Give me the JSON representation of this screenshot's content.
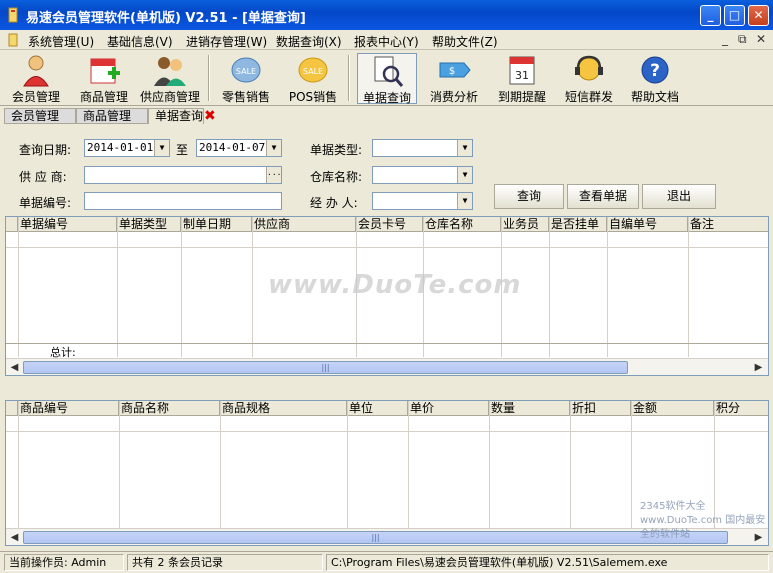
{
  "window": {
    "title": "易速会员管理软件(单机版) V2.51 - [单据查询]",
    "buttons": {
      "minimize": "_",
      "maximize": "□",
      "close": "✕"
    }
  },
  "menu": {
    "items": [
      "系统管理(U)",
      "基础信息(V)",
      "进销存管理(W)",
      "数据查询(X)",
      "报表中心(Y)",
      "帮助文件(Z)"
    ],
    "mdi_controls": [
      "_",
      "⧉",
      "✕"
    ]
  },
  "toolbar": {
    "buttons": [
      {
        "label": "会员管理",
        "icon": "member-icon"
      },
      {
        "label": "商品管理",
        "icon": "goods-icon"
      },
      {
        "label": "供应商管理",
        "icon": "supplier-icon"
      },
      {
        "label": "零售销售",
        "icon": "sale-icon"
      },
      {
        "label": "POS销售",
        "icon": "pos-sale-icon"
      },
      {
        "label": "单据查询",
        "icon": "doc-search-icon"
      },
      {
        "label": "消费分析",
        "icon": "consume-analysis-icon"
      },
      {
        "label": "到期提醒",
        "icon": "calendar-icon"
      },
      {
        "label": "短信群发",
        "icon": "sms-icon"
      },
      {
        "label": "帮助文档",
        "icon": "help-icon"
      }
    ]
  },
  "tabs": [
    "会员管理",
    "商品管理",
    "单据查询"
  ],
  "filter": {
    "date_label": "查询日期:",
    "date_from": "2014-01-01",
    "to_label": "至",
    "date_to": "2014-01-07",
    "doc_type_label": "单据类型:",
    "doc_type_value": "",
    "supplier_label": "供 应 商:",
    "supplier_value": "",
    "supplier_btn": "···",
    "warehouse_label": "仓库名称:",
    "warehouse_value": "",
    "doc_no_label": "单据编号:",
    "doc_no_value": "",
    "handler_label": "经 办 人:",
    "handler_value": "",
    "query_btn": "查询",
    "view_btn": "查看单据",
    "exit_btn": "退出"
  },
  "grid1": {
    "columns": [
      "单据编号",
      "单据类型",
      "制单日期",
      "供应商",
      "会员卡号",
      "仓库名称",
      "业务员",
      "是否挂单",
      "自编单号",
      "备注"
    ],
    "total_label": "总计:",
    "scroll_mark": "|||"
  },
  "grid2": {
    "columns": [
      "商品编号",
      "商品名称",
      "商品规格",
      "单位",
      "单价",
      "数量",
      "折扣",
      "金额",
      "积分"
    ],
    "scroll_mark": "|||"
  },
  "statusbar": {
    "operator": "当前操作员: Admin",
    "count": "共有 2 条会员记录",
    "path": "C:\\Program Files\\易速会员管理软件(单机版) V2.51\\Salemem.exe"
  },
  "watermark": {
    "text": "www.DuoTe.com",
    "corner": "2345软件大全 www.DuoTe.com 国内最安全的软件站"
  },
  "colors": {
    "title_bar": "#0a5fdc",
    "window_bg": "#ece9d8",
    "grid_border": "#7f9db9"
  }
}
